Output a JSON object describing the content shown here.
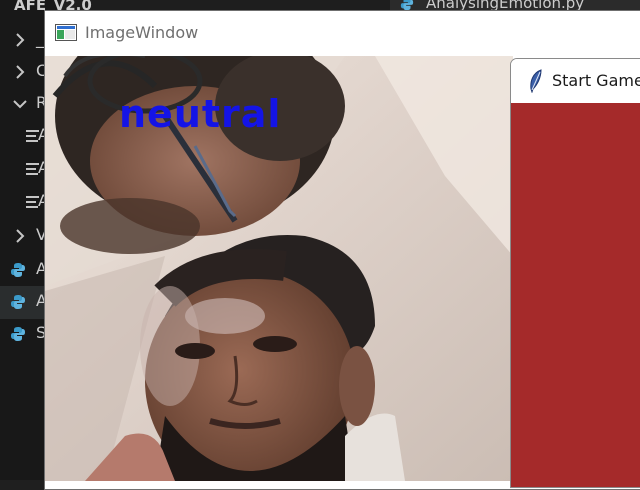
{
  "editor": {
    "explorer_title": "AFE_V2.0",
    "tree": [
      {
        "kind": "folder-collapsed",
        "label": "_"
      },
      {
        "kind": "folder-collapsed",
        "label": "C"
      },
      {
        "kind": "folder-expanded",
        "label": "R"
      },
      {
        "kind": "file",
        "label": "A"
      },
      {
        "kind": "file",
        "label": "A"
      },
      {
        "kind": "file",
        "label": "A"
      },
      {
        "kind": "folder-collapsed",
        "label": "V"
      },
      {
        "kind": "python",
        "label": "A"
      },
      {
        "kind": "python",
        "label": "A",
        "selected": true
      },
      {
        "kind": "python",
        "label": "S"
      }
    ],
    "open_tab": "AnalysingEmotion.py",
    "colors": {
      "background": "#1e1e1e",
      "sidebar": "#181818",
      "python_icon": "#3b9ac9"
    }
  },
  "image_window": {
    "title": "ImageWindow",
    "emotion_label": "neutral",
    "label_color": "#1414e6"
  },
  "game_window": {
    "title": "Start Game",
    "body_color": "#a52a2a"
  }
}
